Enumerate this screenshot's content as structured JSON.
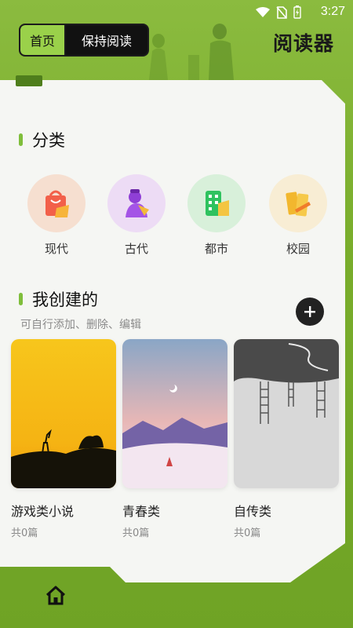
{
  "status_bar": {
    "time": "3:27",
    "icons": [
      "wifi-icon",
      "no-sim-icon",
      "battery-charging-icon"
    ]
  },
  "header": {
    "tabs": [
      {
        "label": "首页",
        "active": true
      },
      {
        "label": "保持阅读",
        "active": false
      }
    ],
    "app_title": "阅读器"
  },
  "categories": {
    "title": "分类",
    "items": [
      {
        "label": "现代",
        "icon": "shopping-bag-icon",
        "color": "#f6d9c9"
      },
      {
        "label": "古代",
        "icon": "ancient-figure-icon",
        "color": "#ecdcf4"
      },
      {
        "label": "都市",
        "icon": "city-building-icon",
        "color": "#d6efd7"
      },
      {
        "label": "校园",
        "icon": "school-pencil-icon",
        "color": "#f7ecd3"
      }
    ]
  },
  "my_created": {
    "title": "我创建的",
    "subtitle": "可自行添加、删除、编辑",
    "add_icon": "plus-icon",
    "books": [
      {
        "name": "游戏类小说",
        "count": "共0篇",
        "cover": "sunset-deer"
      },
      {
        "name": "青春类",
        "count": "共0篇",
        "cover": "pink-mountains"
      },
      {
        "name": "自传类",
        "count": "共0篇",
        "cover": "ladders-grey"
      }
    ]
  },
  "bottom_nav": {
    "home_icon": "home-icon"
  },
  "colors": {
    "accent": "#7fbe3b",
    "background_green": "#79ad2b",
    "dark": "#111111"
  }
}
